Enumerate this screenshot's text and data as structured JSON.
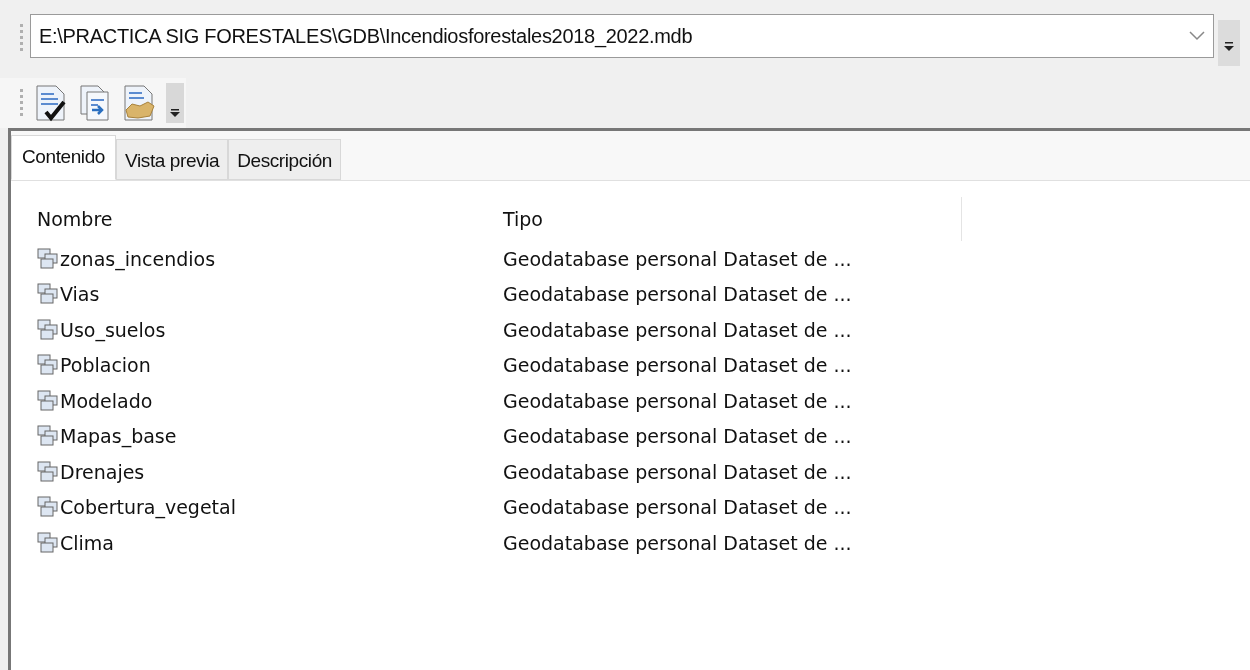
{
  "address_bar": {
    "value": "E:\\PRACTICA SIG FORESTALES\\GDB\\Incendiosforestales2018_2022.mdb"
  },
  "tabs": [
    {
      "label": "Contenido",
      "selected": true
    },
    {
      "label": "Vista previa",
      "selected": false
    },
    {
      "label": "Descripción",
      "selected": false
    }
  ],
  "table": {
    "columns": [
      "Nombre",
      "Tipo"
    ],
    "rows": [
      {
        "name": "zonas_incendios",
        "type": "Geodatabase personal Dataset de ..."
      },
      {
        "name": "Vias",
        "type": "Geodatabase personal Dataset de ..."
      },
      {
        "name": "Uso_suelos",
        "type": "Geodatabase personal Dataset de ..."
      },
      {
        "name": "Poblacion",
        "type": "Geodatabase personal Dataset de ..."
      },
      {
        "name": "Modelado",
        "type": "Geodatabase personal Dataset de ..."
      },
      {
        "name": "Mapas_base",
        "type": "Geodatabase personal Dataset de ..."
      },
      {
        "name": "Drenajes",
        "type": "Geodatabase personal Dataset de ..."
      },
      {
        "name": "Cobertura_vegetal",
        "type": "Geodatabase personal Dataset de ..."
      },
      {
        "name": "Clima",
        "type": "Geodatabase personal Dataset de ..."
      }
    ]
  }
}
